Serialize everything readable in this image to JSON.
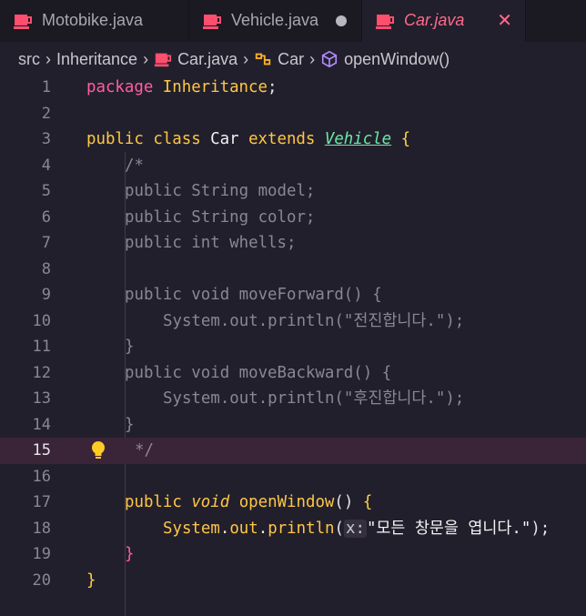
{
  "tabs": [
    {
      "label": "Motobike.java",
      "state": "normal"
    },
    {
      "label": "Vehicle.java",
      "state": "modified"
    },
    {
      "label": "Car.java",
      "state": "active"
    }
  ],
  "breadcrumb": {
    "items": [
      "src",
      "Inheritance",
      "Car.java",
      "Car",
      "openWindow()"
    ]
  },
  "editor": {
    "current_line": 15,
    "lines": [
      {
        "n": "1",
        "t": ""
      },
      {
        "n": "2",
        "t": ""
      },
      {
        "n": "3",
        "t": ""
      },
      {
        "n": "4",
        "t": "/*"
      },
      {
        "n": "5",
        "t": "public String model;"
      },
      {
        "n": "6",
        "t": "public String color;"
      },
      {
        "n": "7",
        "t": "public int whells;"
      },
      {
        "n": "8",
        "t": ""
      },
      {
        "n": "9",
        "t": "public void moveForward() {"
      },
      {
        "n": "10",
        "t": "System.out.println(\"전진합니다.\");"
      },
      {
        "n": "11",
        "t": "}"
      },
      {
        "n": "12",
        "t": "public void moveBackward() {"
      },
      {
        "n": "13",
        "t": "System.out.println(\"후진합니다.\");"
      },
      {
        "n": "14",
        "t": "}"
      },
      {
        "n": "15",
        "t": "*/"
      },
      {
        "n": "16",
        "t": ""
      },
      {
        "n": "17",
        "t": ""
      },
      {
        "n": "18",
        "t": ""
      },
      {
        "n": "19",
        "t": "}"
      },
      {
        "n": "20",
        "t": "}"
      }
    ],
    "tokens": {
      "package_kw": "package",
      "package_name": "Inheritance",
      "semicolon": ";",
      "public_kw": "public",
      "class_kw": "class",
      "class_name": "Car",
      "extends_kw": "extends",
      "super_name": "Vehicle",
      "open_brace": "{",
      "void_kw": "void",
      "method_name": "openWindow",
      "parens": "()",
      "system": "System",
      "out": "out",
      "println": "println",
      "hint": "x:",
      "message": "\"모든 창문을 엽니다.\"",
      "close_stmt": ");"
    }
  },
  "colors": {
    "background": "#221f2c",
    "tab_bar": "#1b1922",
    "active_tab_text": "#ff6b8b",
    "keyword": "#ff5ea0",
    "type_ref": "#6ee7a8",
    "function": "#ffc745",
    "comment": "#8a8794",
    "highlight_line": "#3a2437"
  },
  "icons": {
    "java_file": "coffee-cup-icon",
    "class": "class-symbol-icon",
    "method": "method-cube-icon",
    "modified": "unsaved-dot-icon",
    "close": "close-icon",
    "lightbulb": "lightbulb-icon"
  }
}
